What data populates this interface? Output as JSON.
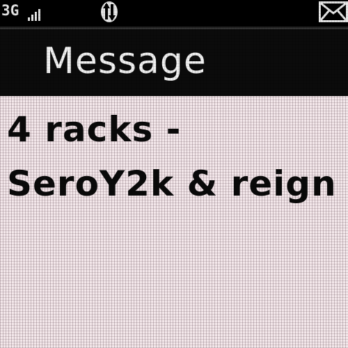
{
  "status_bar": {
    "network": "3G",
    "signal_icon": "signal-strength-icon",
    "sync_icon": "data-transfer-icon",
    "mail_icon": "envelope-icon"
  },
  "header": {
    "title": "Message"
  },
  "message": {
    "lines": [
      "4 racks -",
      "SeroY2k & reign"
    ]
  },
  "colors": {
    "status_bar_bg": "#000000",
    "title_bar_bg": "#0b0b0b",
    "title_text": "#f2f2f2",
    "body_bg": "#f3e7ea",
    "body_text": "#0a0a0a"
  }
}
